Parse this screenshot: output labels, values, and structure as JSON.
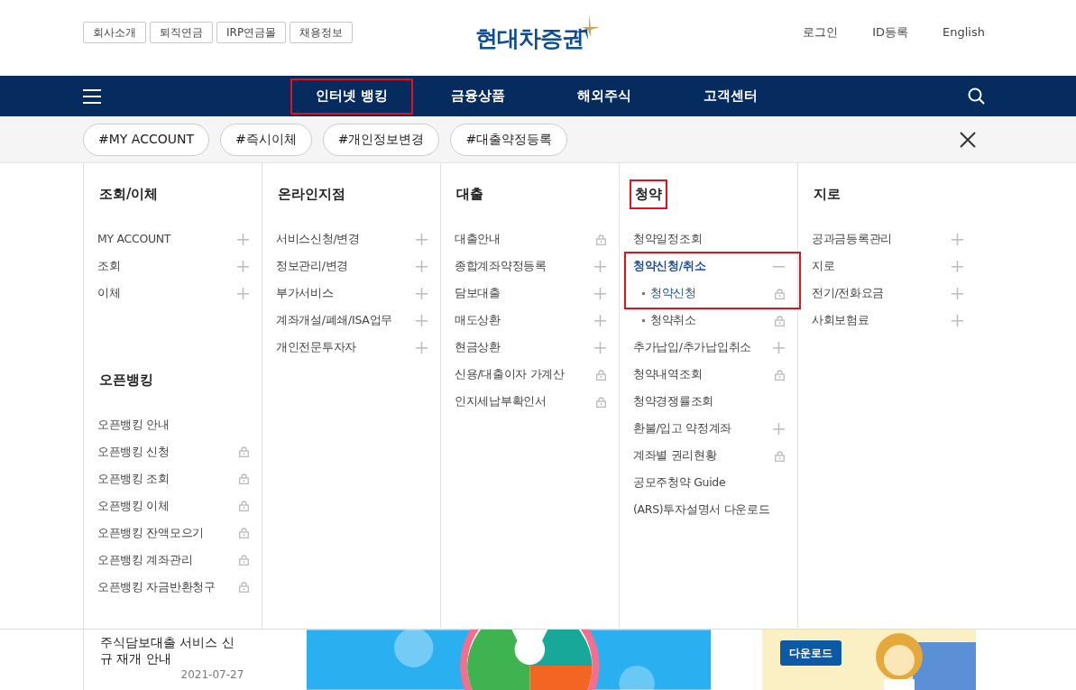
{
  "top_links": [
    "회사소개",
    "퇴직연금",
    "IRP연금몰",
    "채용정보"
  ],
  "logo": {
    "text": "현대차증권"
  },
  "util_links": [
    "로그인",
    "ID등록",
    "English"
  ],
  "nav": [
    {
      "label": "인터넷 뱅킹",
      "highlighted": true
    },
    {
      "label": "금융상품",
      "highlighted": false
    },
    {
      "label": "해외주식",
      "highlighted": false
    },
    {
      "label": "고객센터",
      "highlighted": false
    }
  ],
  "tags": [
    "#MY ACCOUNT",
    "#즉시이체",
    "#개인정보변경",
    "#대출약정등록"
  ],
  "menu_columns": [
    {
      "sections": [
        {
          "title": "조회/이체",
          "highlighted": false,
          "items": [
            {
              "label": "MY ACCOUNT",
              "kind": "expand",
              "expanded": false
            },
            {
              "label": "조회",
              "kind": "expand",
              "expanded": false
            },
            {
              "label": "이체",
              "kind": "expand",
              "expanded": false
            }
          ]
        },
        {
          "title": "오픈뱅킹",
          "highlighted": false,
          "items": [
            {
              "label": "오픈뱅킹 안내",
              "kind": "link"
            },
            {
              "label": "오픈뱅킹 신청",
              "kind": "lock"
            },
            {
              "label": "오픈뱅킹 조회",
              "kind": "lock"
            },
            {
              "label": "오픈뱅킹 이체",
              "kind": "lock"
            },
            {
              "label": "오픈뱅킹 잔액모으기",
              "kind": "lock"
            },
            {
              "label": "오픈뱅킹 계좌관리",
              "kind": "lock"
            },
            {
              "label": "오픈뱅킹 자금반환청구",
              "kind": "lock"
            }
          ]
        }
      ]
    },
    {
      "sections": [
        {
          "title": "온라인지점",
          "highlighted": false,
          "items": [
            {
              "label": "서비스신청/변경",
              "kind": "expand",
              "expanded": false
            },
            {
              "label": "정보관리/변경",
              "kind": "expand",
              "expanded": false
            },
            {
              "label": "부가서비스",
              "kind": "expand",
              "expanded": false
            },
            {
              "label": "계좌개설/폐쇄/ISA업무",
              "kind": "expand",
              "expanded": false
            },
            {
              "label": "개인전문투자자",
              "kind": "expand",
              "expanded": false
            }
          ]
        }
      ]
    },
    {
      "sections": [
        {
          "title": "대출",
          "highlighted": false,
          "items": [
            {
              "label": "대출안내",
              "kind": "lock"
            },
            {
              "label": "종합계좌약정등록",
              "kind": "expand",
              "expanded": false
            },
            {
              "label": "담보대출",
              "kind": "expand",
              "expanded": false
            },
            {
              "label": "매도상환",
              "kind": "expand",
              "expanded": false
            },
            {
              "label": "현금상환",
              "kind": "expand",
              "expanded": false
            },
            {
              "label": "신용/대출이자 가계산",
              "kind": "lock"
            },
            {
              "label": "인지세납부확인서",
              "kind": "lock"
            }
          ]
        }
      ]
    },
    {
      "sections": [
        {
          "title": "청약",
          "highlighted": true,
          "items": [
            {
              "label": "청약일정조회",
              "kind": "link"
            },
            {
              "label": "청약신청/취소",
              "kind": "expand",
              "expanded": true,
              "highlighted": true,
              "children": [
                {
                  "label": "청약신청",
                  "kind": "lock",
                  "selected": true,
                  "highlighted": true
                },
                {
                  "label": "청약취소",
                  "kind": "lock",
                  "selected": false,
                  "highlighted": false
                }
              ]
            },
            {
              "label": "추가납입/추가납입취소",
              "kind": "expand",
              "expanded": false
            },
            {
              "label": "청약내역조회",
              "kind": "lock"
            },
            {
              "label": "청약경쟁률조회",
              "kind": "link"
            },
            {
              "label": "환불/입고 약정계좌",
              "kind": "expand",
              "expanded": false
            },
            {
              "label": "계좌별 권리현황",
              "kind": "lock"
            },
            {
              "label": "공모주청약 Guide",
              "kind": "link"
            },
            {
              "label": "(ARS)투자설명서 다운로드",
              "kind": "link"
            }
          ]
        }
      ]
    },
    {
      "sections": [
        {
          "title": "지로",
          "highlighted": false,
          "items": [
            {
              "label": "공과금등록관리",
              "kind": "expand",
              "expanded": false
            },
            {
              "label": "지로",
              "kind": "expand",
              "expanded": false
            },
            {
              "label": "전기/전화요금",
              "kind": "expand",
              "expanded": false
            },
            {
              "label": "사회보험료",
              "kind": "expand",
              "expanded": false
            }
          ]
        }
      ]
    }
  ],
  "notice": {
    "title": "주식담보대출 서비스 신규 재개 안내",
    "date": "2021-07-27"
  },
  "banner": {
    "kind": "picture"
  },
  "side_banner": {
    "button": "다운로드"
  }
}
